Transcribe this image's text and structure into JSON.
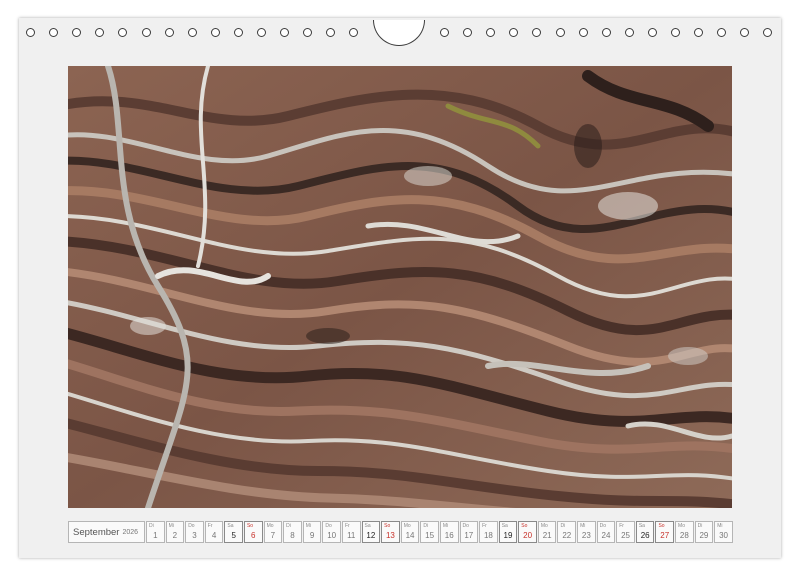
{
  "calendar": {
    "month": "September",
    "year": "2026",
    "days": [
      {
        "wd": "Di",
        "d": "1",
        "type": "weekday"
      },
      {
        "wd": "Mi",
        "d": "2",
        "type": "weekday"
      },
      {
        "wd": "Do",
        "d": "3",
        "type": "weekday"
      },
      {
        "wd": "Fr",
        "d": "4",
        "type": "weekday"
      },
      {
        "wd": "Sa",
        "d": "5",
        "type": "sat"
      },
      {
        "wd": "So",
        "d": "6",
        "type": "sun"
      },
      {
        "wd": "Mo",
        "d": "7",
        "type": "weekday"
      },
      {
        "wd": "Di",
        "d": "8",
        "type": "weekday"
      },
      {
        "wd": "Mi",
        "d": "9",
        "type": "weekday"
      },
      {
        "wd": "Do",
        "d": "10",
        "type": "weekday"
      },
      {
        "wd": "Fr",
        "d": "11",
        "type": "weekday"
      },
      {
        "wd": "Sa",
        "d": "12",
        "type": "sat"
      },
      {
        "wd": "So",
        "d": "13",
        "type": "sun"
      },
      {
        "wd": "Mo",
        "d": "14",
        "type": "weekday"
      },
      {
        "wd": "Di",
        "d": "15",
        "type": "weekday"
      },
      {
        "wd": "Mi",
        "d": "16",
        "type": "weekday"
      },
      {
        "wd": "Do",
        "d": "17",
        "type": "weekday"
      },
      {
        "wd": "Fr",
        "d": "18",
        "type": "weekday"
      },
      {
        "wd": "Sa",
        "d": "19",
        "type": "sat"
      },
      {
        "wd": "So",
        "d": "20",
        "type": "sun"
      },
      {
        "wd": "Mo",
        "d": "21",
        "type": "weekday"
      },
      {
        "wd": "Di",
        "d": "22",
        "type": "weekday"
      },
      {
        "wd": "Mi",
        "d": "23",
        "type": "weekday"
      },
      {
        "wd": "Do",
        "d": "24",
        "type": "weekday"
      },
      {
        "wd": "Fr",
        "d": "25",
        "type": "weekday"
      },
      {
        "wd": "Sa",
        "d": "26",
        "type": "sat"
      },
      {
        "wd": "So",
        "d": "27",
        "type": "sun"
      },
      {
        "wd": "Mo",
        "d": "28",
        "type": "weekday"
      },
      {
        "wd": "Di",
        "d": "29",
        "type": "weekday"
      },
      {
        "wd": "Mi",
        "d": "30",
        "type": "weekday"
      }
    ]
  },
  "photo": {
    "subject": "rock-texture",
    "colors": {
      "rust": "#8a5a48",
      "dark": "#3a2a24",
      "grey": "#b7b4b0",
      "white": "#e4e2de",
      "lichen": "#9a9640"
    }
  },
  "colors": {
    "sunday": "#c8322b",
    "page": "#f0f0f0",
    "ring": "#3c3c3c"
  }
}
